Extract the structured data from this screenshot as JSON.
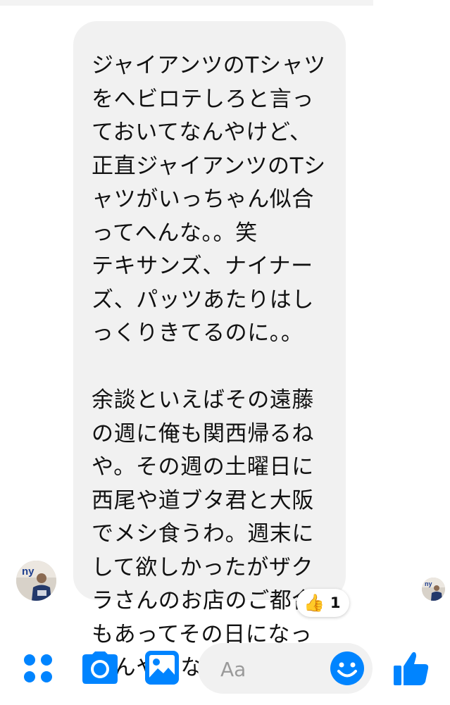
{
  "message": {
    "lines_part1": [
      "ジャイアンツのTシャツ",
      "をへビロテしろと言っ",
      "ておいてなんやけど、",
      "正直ジャイアンツのTシ",
      "ャツがいっちゃん似合",
      "ってへんな。。笑",
      "テキサンズ、ナイナー",
      "ズ、パッツあたりはし",
      "っくりきてるのに。。"
    ],
    "lines_part2": [
      "余談といえばその遠藤",
      "の週に俺も関西帰るね",
      "や。その週の土曜日に",
      "西尾や道ブタ君と大阪",
      "でメシ食うわ。週末に",
      "して欲しかったがザク",
      "ラさんのお店のご都合",
      "もあってその日になっ",
      "たんやろな、、無念！"
    ]
  },
  "reaction": {
    "emoji": "👍",
    "count": "1"
  },
  "composer": {
    "placeholder": "Aa",
    "icons": [
      "apps-icon",
      "camera-icon",
      "photo-icon",
      "emoji-icon",
      "thumbs-up-icon"
    ]
  },
  "colors": {
    "accent": "#0084ff",
    "bubble": "#f1f1f1",
    "text": "#111111"
  }
}
